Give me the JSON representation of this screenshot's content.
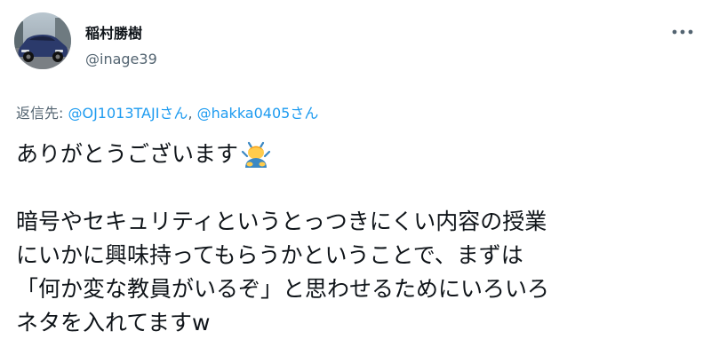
{
  "author": {
    "name": "稲村勝樹",
    "handle": "@inage39"
  },
  "reply": {
    "prefix": "返信先: ",
    "mention1": "@OJ1013TAJIさん",
    "separator": ", ",
    "mention2": "@hakka0405さん"
  },
  "tweet": {
    "line1": "ありがとうございます",
    "line1_emoji": "person-bowing-emoji",
    "line2": "暗号やセキュリティというとっつきにくい内容の授業",
    "line3": "にいかに興味持ってもらうかということで、まずは",
    "line4": "「何か変な教員がいるぞ」と思わせるためにいろいろ",
    "line5": "ネタを入れてますw"
  },
  "icons": {
    "more": "more-options-icon",
    "avatar": "avatar-car-photo"
  },
  "colors": {
    "text": "#0f1419",
    "secondary": "#536471",
    "link": "#1d9bf0",
    "background": "#ffffff"
  }
}
